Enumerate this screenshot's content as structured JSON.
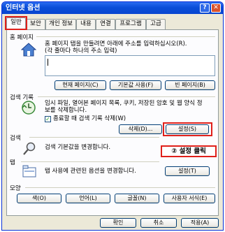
{
  "window": {
    "title": "인터넷 옵션"
  },
  "title_buttons": {
    "help": "?",
    "close": "✕"
  },
  "tabs": [
    "일반",
    "보안",
    "개인 정보",
    "내용",
    "연결",
    "프로그램",
    "고급"
  ],
  "home": {
    "heading": "홈 페이지",
    "desc_line1": "홈 페이지 탭을 만들려면 아래에 주소를 입력하십시오(R).",
    "desc_line2": "(각 줄마다 하나의 주소 입력)",
    "buttons": {
      "current": "현재 페이지(C)",
      "default": "기본값 사용(F)",
      "blank": "빈 페이지(B)"
    }
  },
  "history": {
    "heading": "검색 기록",
    "desc_line1": "임시 파일, 열어본 페이지 목록, 쿠키, 저장된 암호 및 웹 양식 정",
    "desc_line2": "보를 삭제합니다.",
    "checkbox_label": "종료할 때 검색 기록 삭제(W)",
    "checkbox_checked": true,
    "buttons": {
      "delete": "삭제(D)...",
      "settings": "설정(S)"
    }
  },
  "search": {
    "heading": "검색",
    "desc": "검색 기본값을 변경합니다.",
    "buttons": {
      "settings": "설정(I)"
    }
  },
  "tabs_section": {
    "heading": "탭",
    "desc": "탭 사용에 관련된 옵션을 변경합니다.",
    "buttons": {
      "settings": "설정(T)"
    }
  },
  "appearance": {
    "heading": "모양",
    "buttons": {
      "colors": "색(O)",
      "languages": "언어(L)",
      "fonts": "글꼴(N)",
      "accessibility": "사용자 서식(E)"
    }
  },
  "footer": {
    "ok": "확인",
    "cancel": "취소",
    "apply": "적용(A)"
  },
  "annotation": {
    "text": "② 설정 클릭"
  },
  "colors": {
    "highlight": "#e0201a",
    "titlebar": "#0a4ed8"
  }
}
